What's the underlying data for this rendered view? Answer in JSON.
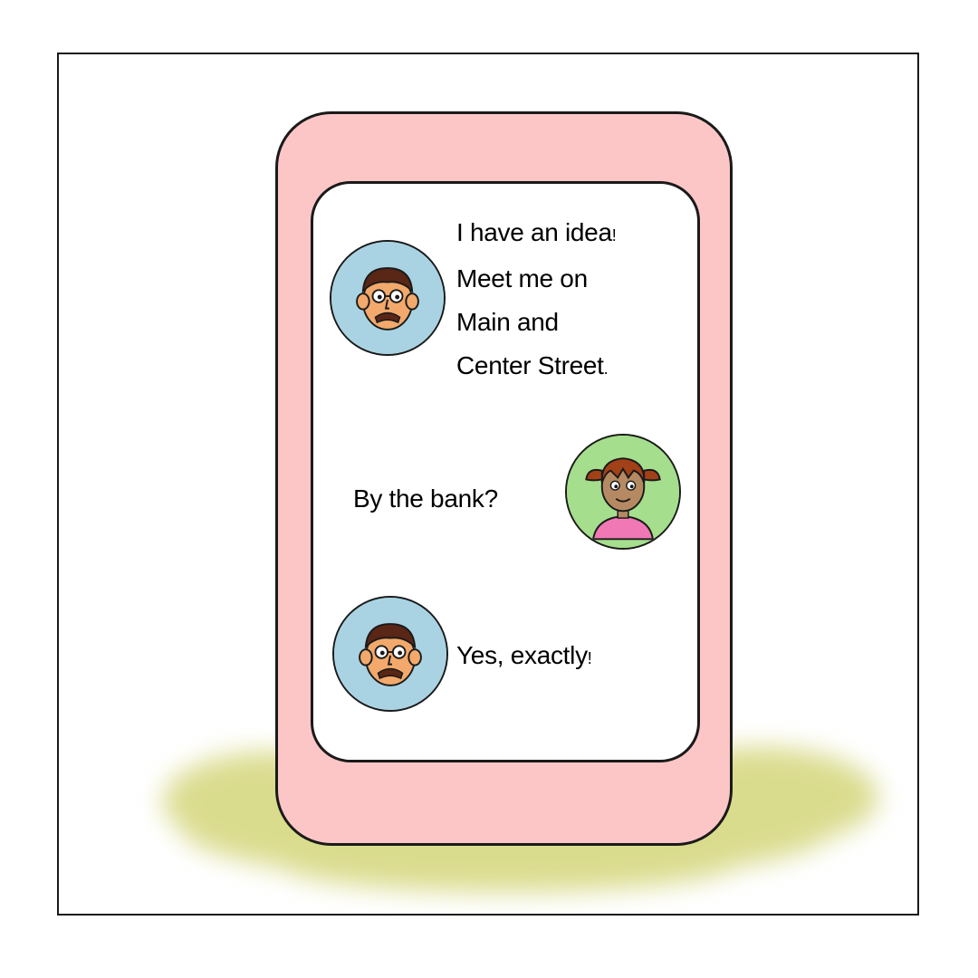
{
  "colors": {
    "phone_body": "#fdc6c6",
    "screen": "#ffffff",
    "avatar_man_bg": "#a9d3e2",
    "avatar_girl_bg": "#a5de8c",
    "grass": "#d4d67a"
  },
  "messages": [
    {
      "sender": "man",
      "avatar_icon": "man-with-glasses-avatar-icon",
      "lines": [
        "I have an idea",
        "Meet me on",
        "Main and",
        "Center Street"
      ],
      "line_endings": [
        "!",
        "",
        "",
        "."
      ]
    },
    {
      "sender": "girl",
      "avatar_icon": "girl-with-pigtails-avatar-icon",
      "lines": [
        "By the bank?"
      ]
    },
    {
      "sender": "man",
      "avatar_icon": "man-with-glasses-avatar-icon",
      "lines": [
        "Yes, exactly"
      ],
      "line_endings": [
        "!"
      ]
    }
  ]
}
